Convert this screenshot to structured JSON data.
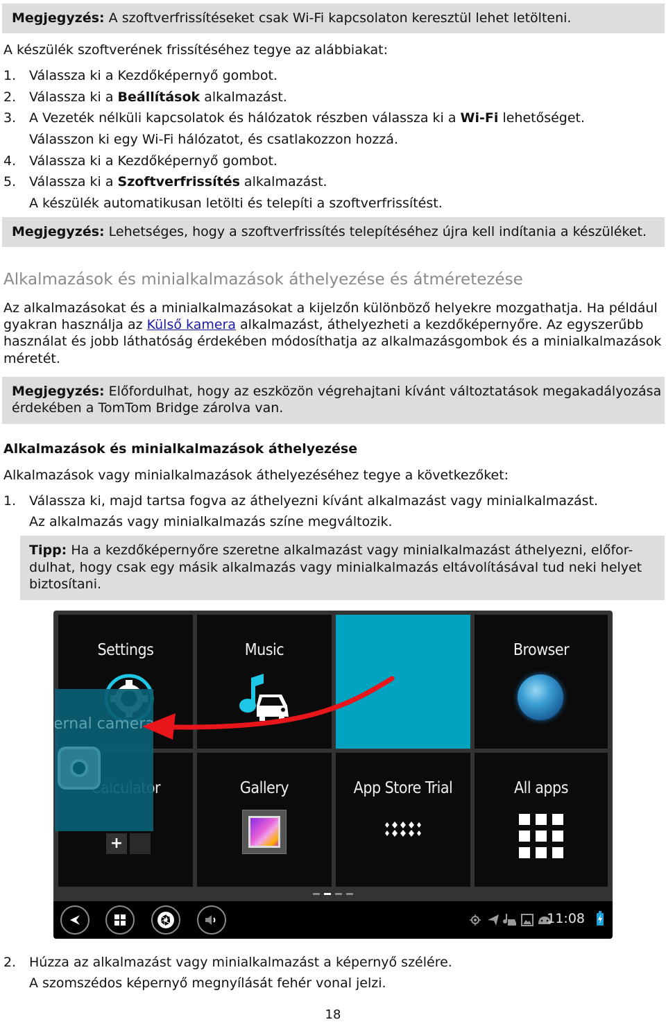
{
  "note1": {
    "label": "Megjegyzés:",
    "text": " A szoftverfrissítéseket csak Wi-Fi kapcsolaton keresztül lehet letölteni."
  },
  "intro": "A készülék szoftverének frissítéséhez tegye az alábbiakat:",
  "steps_update": [
    {
      "num": "1.",
      "pre": "Válassza ki a Kezdőképernyő gombot.",
      "bold": "",
      "post": ""
    },
    {
      "num": "2.",
      "pre": "Válassza ki a ",
      "bold": "Beállítások",
      "post": " alkalmazást."
    },
    {
      "num": "3.",
      "pre": "A Vezeték nélküli kapcsolatok és hálózatok részben válassza ki a ",
      "bold": "Wi-Fi",
      "post": " lehetőséget.",
      "sub": "Válasszon ki egy Wi-Fi hálózatot, és csatlakozzon hozzá."
    },
    {
      "num": "4.",
      "pre": "Válassza ki a Kezdőképernyő gombot.",
      "bold": "",
      "post": ""
    },
    {
      "num": "5.",
      "pre": "Válassza ki a ",
      "bold": "Szoftverfrissítés",
      "post": " alkalmazást.",
      "sub": "A készülék automatikusan letölti és telepíti a szoftverfrissítést."
    }
  ],
  "note2": {
    "label": "Megjegyzés:",
    "text": " Lehetséges, hogy a szoftverfrissítés telepítéséhez újra kell indítania a készüléket."
  },
  "section_title": "Alkalmazások és minialkalmazások áthelyezése és átméretezése",
  "paragraph": {
    "line1": "Az alkalmazásokat és a minialkalmazásokat a kijelzőn különböző helyekre mozgathatja. Ha például",
    "line2_pre": "gyakran használja az ",
    "line2_link": "Külső kamera",
    "line2_post": " alkalmazást, áthelyezheti a kezdőképernyőre. Az egyszerűbb",
    "line3": "használat és jobb láthatóság érdekében módosíthatja az alkalmazásgombok és a minialkalmazások",
    "line4": "méretét."
  },
  "note3": {
    "label": "Megjegyzés:",
    "line1": " Előfordulhat, hogy az eszközön végrehajtani kívánt változtatások megakadályozása",
    "line2": "érdekében a TomTom Bridge zárolva van."
  },
  "subsection_title": "Alkalmazások és minialkalmazások áthelyezése",
  "subsection_intro": "Alkalmazások vagy minialkalmazások áthelyezéséhez tegye a következőket:",
  "step_move1": {
    "num": "1.",
    "text": "Válassza ki, majd tartsa fogva az áthelyezni kívánt alkalmazást vagy minialkalmazást.",
    "sub": "Az alkalmazás vagy minialkalmazás színe megváltozik."
  },
  "tip": {
    "label": "Tipp:",
    "line1": " Ha a kezdőképernyőre szeretne alkalmazást vagy minialkalmazást áthelyezni, elő­for-",
    "line2": "dulhat, hogy csak egy másik alkalmazás vagy minialkalmazás eltávolításával tud neki helyet",
    "line3": "biztosítani."
  },
  "device": {
    "tiles": [
      {
        "label": "Settings",
        "icon": "settings-gear-icon"
      },
      {
        "label": "Music",
        "icon": "music-car-icon"
      },
      {
        "label": "",
        "icon": "empty-drop-target"
      },
      {
        "label": "Browser",
        "icon": "globe-icon"
      },
      {
        "label": "Calculator",
        "icon": "calculator-icon"
      },
      {
        "label": "Gallery",
        "icon": "gallery-picture-icon"
      },
      {
        "label": "App Store Trial",
        "icon": "app-store-dots-icon"
      },
      {
        "label": "All apps",
        "icon": "grid-icon"
      }
    ],
    "dragged_label": "ernal camera",
    "highlight_color": "#00a3bf",
    "dragged_color": "#0a5f73",
    "arrow_color": "#e8161b",
    "nav_buttons": [
      "back-icon",
      "home-grid-icon",
      "camera-shutter-icon",
      "volume-icon"
    ],
    "status_icons": [
      "location-target-icon",
      "navigation-arrow-icon",
      "music-car-status-icon",
      "image-icon",
      "android-icon"
    ],
    "clock": "11:08"
  },
  "step_move2": {
    "num": "2.",
    "text": "Húzza az alkalmazást vagy minialkalmazást a képernyő szélére.",
    "sub": "A szomszédos képernyő megnyílását fehér vonal jelzi."
  },
  "page_number": "18"
}
